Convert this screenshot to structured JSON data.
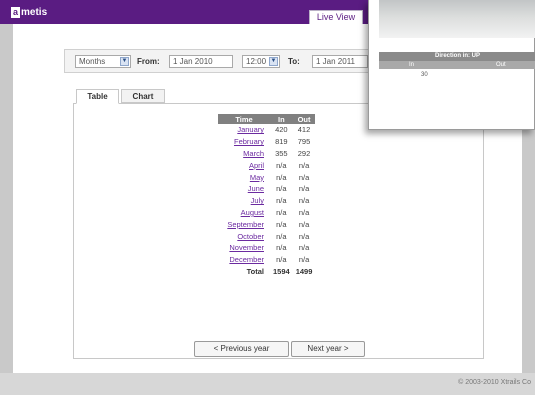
{
  "app": {
    "logo_box": "a",
    "logo_text": "metis",
    "live_view_label": "Live View",
    "copyright": "© 2003-2010 Xtrails Co"
  },
  "filters": {
    "period": "Months",
    "from_label": "From:",
    "from_date": "1 Jan 2010",
    "from_time": "12:00",
    "to_label": "To:",
    "to_date": "1 Jan 2011"
  },
  "tabs": [
    {
      "label": "Table",
      "active": true
    },
    {
      "label": "Chart",
      "active": false
    }
  ],
  "table": {
    "headers": [
      "Time",
      "In",
      "Out"
    ],
    "rows": [
      {
        "month": "January",
        "in": "420",
        "out": "412"
      },
      {
        "month": "February",
        "in": "819",
        "out": "795"
      },
      {
        "month": "March",
        "in": "355",
        "out": "292"
      },
      {
        "month": "April",
        "in": "n/a",
        "out": "n/a"
      },
      {
        "month": "May",
        "in": "n/a",
        "out": "n/a"
      },
      {
        "month": "June",
        "in": "n/a",
        "out": "n/a"
      },
      {
        "month": "July",
        "in": "n/a",
        "out": "n/a"
      },
      {
        "month": "August",
        "in": "n/a",
        "out": "n/a"
      },
      {
        "month": "September",
        "in": "n/a",
        "out": "n/a"
      },
      {
        "month": "October",
        "in": "n/a",
        "out": "n/a"
      },
      {
        "month": "November",
        "in": "n/a",
        "out": "n/a"
      },
      {
        "month": "December",
        "in": "n/a",
        "out": "n/a"
      }
    ],
    "total": {
      "label": "Total",
      "in": "1594",
      "out": "1499"
    }
  },
  "nav": {
    "prev_label": "< Previous year",
    "next_label": "Next year >"
  },
  "popup": {
    "header": "Direction in: UP",
    "col_in": "In",
    "col_out": "Out",
    "value_in": "30"
  }
}
